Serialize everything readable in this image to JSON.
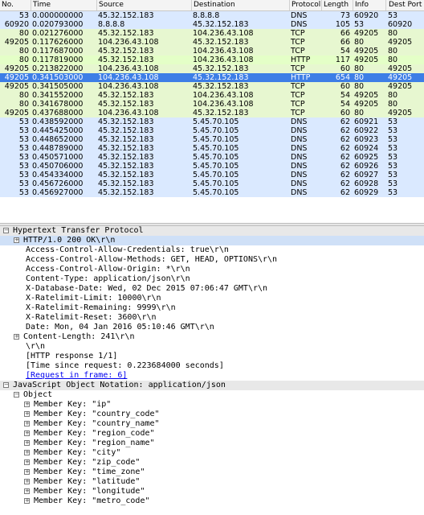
{
  "packet_list": {
    "columns": [
      "No.",
      "Time",
      "Source",
      "Destination",
      "Protocol",
      "Length",
      "Info",
      "Dest Port"
    ],
    "rows": [
      {
        "no": "53",
        "time": "0.000000000",
        "src": "45.32.152.183",
        "dst": "8.8.8.8",
        "proto": "DNS",
        "len": "73",
        "info": "60920",
        "dport": "53",
        "kind": "dns"
      },
      {
        "no": "60920",
        "time": "0.020793000",
        "src": "8.8.8.8",
        "dst": "45.32.152.183",
        "proto": "DNS",
        "len": "105",
        "info": "53",
        "dport": "60920",
        "kind": "dns"
      },
      {
        "no": "80",
        "time": "0.021276000",
        "src": "45.32.152.183",
        "dst": "104.236.43.108",
        "proto": "TCP",
        "len": "66",
        "info": "49205",
        "dport": "80",
        "kind": "tcp"
      },
      {
        "no": "49205",
        "time": "0.117626000",
        "src": "104.236.43.108",
        "dst": "45.32.152.183",
        "proto": "TCP",
        "len": "66",
        "info": "80",
        "dport": "49205",
        "kind": "tcp"
      },
      {
        "no": "80",
        "time": "0.117687000",
        "src": "45.32.152.183",
        "dst": "104.236.43.108",
        "proto": "TCP",
        "len": "54",
        "info": "49205",
        "dport": "80",
        "kind": "tcp"
      },
      {
        "no": "80",
        "time": "0.117819000",
        "src": "45.32.152.183",
        "dst": "104.236.43.108",
        "proto": "HTTP",
        "len": "117",
        "info": "49205",
        "dport": "80",
        "kind": "http"
      },
      {
        "no": "49205",
        "time": "0.213822000",
        "src": "104.236.43.108",
        "dst": "45.32.152.183",
        "proto": "TCP",
        "len": "60",
        "info": "80",
        "dport": "49205",
        "kind": "tcp"
      },
      {
        "no": "49205",
        "time": "0.341503000",
        "src": "104.236.43.108",
        "dst": "45.32.152.183",
        "proto": "HTTP",
        "len": "654",
        "info": "80",
        "dport": "49205",
        "kind": "sel"
      },
      {
        "no": "49205",
        "time": "0.341505000",
        "src": "104.236.43.108",
        "dst": "45.32.152.183",
        "proto": "TCP",
        "len": "60",
        "info": "80",
        "dport": "49205",
        "kind": "tcp"
      },
      {
        "no": "80",
        "time": "0.341552000",
        "src": "45.32.152.183",
        "dst": "104.236.43.108",
        "proto": "TCP",
        "len": "54",
        "info": "49205",
        "dport": "80",
        "kind": "tcp"
      },
      {
        "no": "80",
        "time": "0.341678000",
        "src": "45.32.152.183",
        "dst": "104.236.43.108",
        "proto": "TCP",
        "len": "54",
        "info": "49205",
        "dport": "80",
        "kind": "tcp"
      },
      {
        "no": "49205",
        "time": "0.437688000",
        "src": "104.236.43.108",
        "dst": "45.32.152.183",
        "proto": "TCP",
        "len": "60",
        "info": "80",
        "dport": "49205",
        "kind": "tcp"
      },
      {
        "no": "53",
        "time": "0.438592000",
        "src": "45.32.152.183",
        "dst": "5.45.70.105",
        "proto": "DNS",
        "len": "62",
        "info": "60921",
        "dport": "53",
        "kind": "dns"
      },
      {
        "no": "53",
        "time": "0.445425000",
        "src": "45.32.152.183",
        "dst": "5.45.70.105",
        "proto": "DNS",
        "len": "62",
        "info": "60922",
        "dport": "53",
        "kind": "dns"
      },
      {
        "no": "53",
        "time": "0.448652000",
        "src": "45.32.152.183",
        "dst": "5.45.70.105",
        "proto": "DNS",
        "len": "62",
        "info": "60923",
        "dport": "53",
        "kind": "dns"
      },
      {
        "no": "53",
        "time": "0.448789000",
        "src": "45.32.152.183",
        "dst": "5.45.70.105",
        "proto": "DNS",
        "len": "62",
        "info": "60924",
        "dport": "53",
        "kind": "dns"
      },
      {
        "no": "53",
        "time": "0.450571000",
        "src": "45.32.152.183",
        "dst": "5.45.70.105",
        "proto": "DNS",
        "len": "62",
        "info": "60925",
        "dport": "53",
        "kind": "dns"
      },
      {
        "no": "53",
        "time": "0.450706000",
        "src": "45.32.152.183",
        "dst": "5.45.70.105",
        "proto": "DNS",
        "len": "62",
        "info": "60926",
        "dport": "53",
        "kind": "dns"
      },
      {
        "no": "53",
        "time": "0.454334000",
        "src": "45.32.152.183",
        "dst": "5.45.70.105",
        "proto": "DNS",
        "len": "62",
        "info": "60927",
        "dport": "53",
        "kind": "dns"
      },
      {
        "no": "53",
        "time": "0.456726000",
        "src": "45.32.152.183",
        "dst": "5.45.70.105",
        "proto": "DNS",
        "len": "62",
        "info": "60928",
        "dport": "53",
        "kind": "dns"
      },
      {
        "no": "53",
        "time": "0.456927000",
        "src": "45.32.152.183",
        "dst": "5.45.70.105",
        "proto": "DNS",
        "len": "62",
        "info": "60929",
        "dport": "53",
        "kind": "dns"
      }
    ]
  },
  "details": {
    "rows": [
      {
        "text": "Hypertext Transfer Protocol",
        "indent": 0,
        "exp": "minus",
        "style": "sect"
      },
      {
        "text": "HTTP/1.0 200 OK\\r\\n",
        "indent": 1,
        "exp": "plus",
        "style": "hl"
      },
      {
        "text": "Access-Control-Allow-Credentials: true\\r\\n",
        "indent": 2,
        "exp": "",
        "style": ""
      },
      {
        "text": "Access-Control-Allow-Methods: GET, HEAD, OPTIONS\\r\\n",
        "indent": 2,
        "exp": "",
        "style": ""
      },
      {
        "text": "Access-Control-Allow-Origin: *\\r\\n",
        "indent": 2,
        "exp": "",
        "style": ""
      },
      {
        "text": "Content-Type: application/json\\r\\n",
        "indent": 2,
        "exp": "",
        "style": ""
      },
      {
        "text": "X-Database-Date: Wed, 02 Dec 2015 07:06:47 GMT\\r\\n",
        "indent": 2,
        "exp": "",
        "style": ""
      },
      {
        "text": "X-Ratelimit-Limit: 10000\\r\\n",
        "indent": 2,
        "exp": "",
        "style": ""
      },
      {
        "text": "X-Ratelimit-Remaining: 9999\\r\\n",
        "indent": 2,
        "exp": "",
        "style": ""
      },
      {
        "text": "X-Ratelimit-Reset: 3600\\r\\n",
        "indent": 2,
        "exp": "",
        "style": ""
      },
      {
        "text": "Date: Mon, 04 Jan 2016 05:10:46 GMT\\r\\n",
        "indent": 2,
        "exp": "",
        "style": ""
      },
      {
        "text": "Content-Length: 241\\r\\n",
        "indent": 1,
        "exp": "plus",
        "style": ""
      },
      {
        "text": "\\r\\n",
        "indent": 2,
        "exp": "",
        "style": ""
      },
      {
        "text": "[HTTP response 1/1]",
        "indent": 2,
        "exp": "",
        "style": ""
      },
      {
        "text": "[Time since request: 0.223684000 seconds]",
        "indent": 2,
        "exp": "",
        "style": ""
      },
      {
        "text": "[Request in frame: 6]",
        "indent": 2,
        "exp": "",
        "style": "link"
      },
      {
        "text": "JavaScript Object Notation: application/json",
        "indent": 0,
        "exp": "minus",
        "style": "sect"
      },
      {
        "text": "Object",
        "indent": 1,
        "exp": "minus",
        "style": ""
      },
      {
        "text": "Member Key: \"ip\"",
        "indent": 2,
        "exp": "plus",
        "style": ""
      },
      {
        "text": "Member Key: \"country_code\"",
        "indent": 2,
        "exp": "plus",
        "style": ""
      },
      {
        "text": "Member Key: \"country_name\"",
        "indent": 2,
        "exp": "plus",
        "style": ""
      },
      {
        "text": "Member Key: \"region_code\"",
        "indent": 2,
        "exp": "plus",
        "style": ""
      },
      {
        "text": "Member Key: \"region_name\"",
        "indent": 2,
        "exp": "plus",
        "style": ""
      },
      {
        "text": "Member Key: \"city\"",
        "indent": 2,
        "exp": "plus",
        "style": ""
      },
      {
        "text": "Member Key: \"zip_code\"",
        "indent": 2,
        "exp": "plus",
        "style": ""
      },
      {
        "text": "Member Key: \"time_zone\"",
        "indent": 2,
        "exp": "plus",
        "style": ""
      },
      {
        "text": "Member Key: \"latitude\"",
        "indent": 2,
        "exp": "plus",
        "style": ""
      },
      {
        "text": "Member Key: \"longitude\"",
        "indent": 2,
        "exp": "plus",
        "style": ""
      },
      {
        "text": "Member Key: \"metro_code\"",
        "indent": 2,
        "exp": "plus",
        "style": ""
      }
    ]
  },
  "colors": {
    "dns_row": "#dae9ff",
    "tcp_row": "#e7f7d0",
    "selected_row": "#3d7ee6"
  }
}
